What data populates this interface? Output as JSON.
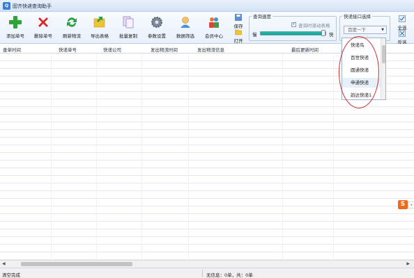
{
  "window": {
    "title": "固齐快递查询助手"
  },
  "toolbar": {
    "buttons": [
      {
        "label": "添加单号",
        "icon": "plus-icon"
      },
      {
        "label": "删除单号",
        "icon": "x-icon"
      },
      {
        "label": "刷新物流",
        "icon": "refresh-icon"
      },
      {
        "label": "导出表格",
        "icon": "export-icon"
      },
      {
        "label": "批量复制",
        "icon": "copy-icon"
      },
      {
        "label": "参数设置",
        "icon": "gear-icon"
      },
      {
        "label": "数据筛选",
        "icon": "filter-icon"
      },
      {
        "label": "会员中心",
        "icon": "member-icon"
      }
    ],
    "save_label": "保存",
    "open_label": "打开",
    "speed_group": {
      "legend": "查询速度",
      "scroll_check_label": "查询时滚动表格",
      "slow_label": "慢",
      "fast_label": "快"
    },
    "api_group": {
      "legend": "快递接口选择",
      "selected_placeholder": "百度一下"
    },
    "select_all_label": "全选",
    "invert_label": "反选"
  },
  "dropdown": {
    "items": [
      "快递鸟",
      "百世快递",
      "圆通快递",
      "申通快递",
      "韵达快递1"
    ],
    "highlighted_index": 3
  },
  "table": {
    "columns": [
      "查单时间",
      "快递单号",
      "快递公司",
      "发出物流时间",
      "发出物流信息",
      "最后更新时间",
      "最"
    ]
  },
  "status": {
    "left": "清空完成",
    "right": "无信息：0单，共：0单"
  },
  "colors": {
    "accent": "#3b7fd1",
    "highlight_circle": "#d22a2a",
    "slider": "#1fa9a0"
  }
}
